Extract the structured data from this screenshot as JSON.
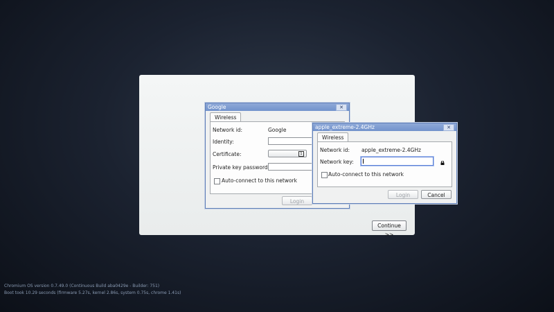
{
  "main_panel": {
    "continue_label": "Continue >>"
  },
  "google_dialog": {
    "title": "Google",
    "close_symbol": "✕",
    "tab_label": "Wireless",
    "network_id_label": "Network id:",
    "network_id_value": "Google",
    "identity_label": "Identity:",
    "certificate_label": "Certificate:",
    "private_key_label": "Private key password:",
    "autoconnect_label": "Auto-connect to this network",
    "login_label": "Login"
  },
  "wifi_dialog": {
    "title": "apple_extreme-2.4GHz",
    "close_symbol": "✕",
    "tab_label": "Wireless",
    "network_id_label": "Network id:",
    "network_id_value": "apple_extreme-2.4GHz",
    "network_key_label": "Network key:",
    "network_key_value": "",
    "autoconnect_label": "Auto-connect to this network",
    "login_label": "Login",
    "cancel_label": "Cancel"
  },
  "footer": {
    "version_line": "Chromium OS version 0.7.49.0 (Continuous Build aba0429e - Builder: 751)",
    "boot_line": "Boot took 10.29 seconds (firmware 5.27s, kernel 2.86s, system 0.75s, chrome 1.41s)"
  },
  "colors": {
    "titlebar": "#7a97cf",
    "background": "#1b2230",
    "panel": "#eef0f0"
  }
}
